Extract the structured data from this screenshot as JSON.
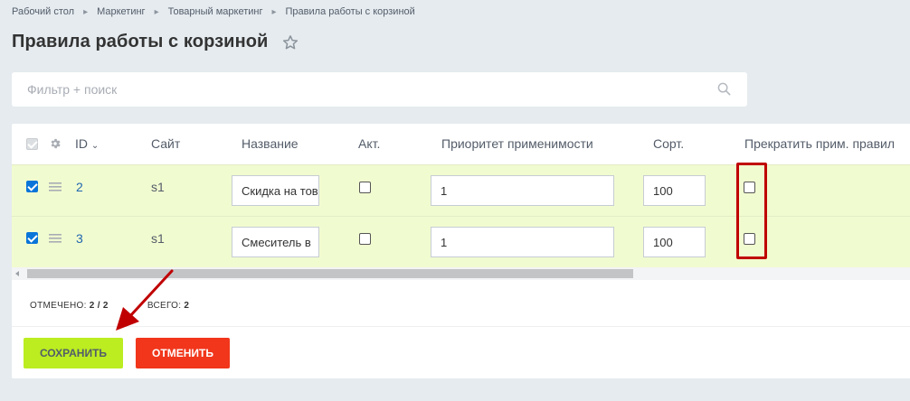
{
  "breadcrumbs": [
    "Рабочий стол",
    "Маркетинг",
    "Товарный маркетинг",
    "Правила работы с корзиной"
  ],
  "page_title": "Правила работы с корзиной",
  "filter": {
    "placeholder": "Фильтр + поиск"
  },
  "table": {
    "columns": {
      "id": "ID",
      "site": "Сайт",
      "name": "Название",
      "active": "Акт.",
      "priority": "Приоритет применимости",
      "sort": "Сорт.",
      "stop": "Прекратить прим. правил"
    },
    "rows": [
      {
        "id": "2",
        "site": "s1",
        "name": "Скидка на тов",
        "priority": "1",
        "sort": "100",
        "checked": true,
        "active": false,
        "stop": false
      },
      {
        "id": "3",
        "site": "s1",
        "name": "Смеситель в",
        "priority": "1",
        "sort": "100",
        "checked": true,
        "active": false,
        "stop": false
      }
    ]
  },
  "footer": {
    "selected_label": "ОТМЕЧЕНО:",
    "selected_value": "2 / 2",
    "total_label": "ВСЕГО:",
    "total_value": "2"
  },
  "buttons": {
    "save": "Сохранить",
    "cancel": "Отменить"
  },
  "colors": {
    "save": "#bbed21",
    "cancel": "#f1361b",
    "highlight": "#c00000",
    "row_selected": "#f1fbd0"
  }
}
